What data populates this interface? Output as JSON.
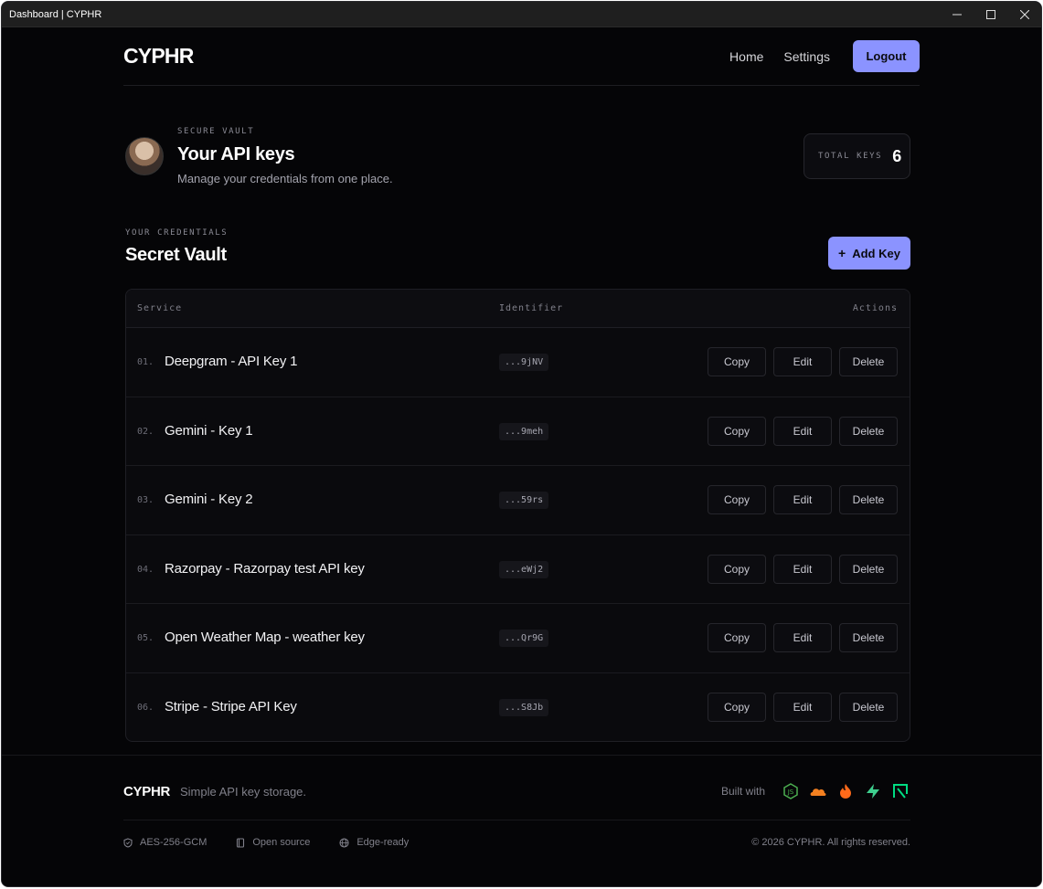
{
  "window": {
    "title": "Dashboard | CYPHR"
  },
  "nav": {
    "logo": "CYPHR",
    "links": [
      "Home",
      "Settings"
    ],
    "logout_label": "Logout"
  },
  "profile": {
    "eyebrow": "SECURE VAULT",
    "title": "Your API keys",
    "subtitle": "Manage your credentials from one place.",
    "total_keys_label": "TOTAL KEYS",
    "total_keys_value": "6"
  },
  "vault": {
    "eyebrow": "YOUR CREDENTIALS",
    "title": "Secret Vault",
    "add_label": "Add Key",
    "add_icon": "+"
  },
  "table": {
    "headers": {
      "service": "Service",
      "identifier": "Identifier",
      "actions": "Actions"
    },
    "action_labels": {
      "copy": "Copy",
      "edit": "Edit",
      "delete": "Delete"
    },
    "rows": [
      {
        "index": "01.",
        "service": "Deepgram - API Key 1",
        "identifier": "...9jNV"
      },
      {
        "index": "02.",
        "service": "Gemini - Key 1",
        "identifier": "...9meh"
      },
      {
        "index": "03.",
        "service": "Gemini - Key 2",
        "identifier": "...59rs"
      },
      {
        "index": "04.",
        "service": "Razorpay - Razorpay test API key",
        "identifier": "...eWj2"
      },
      {
        "index": "05.",
        "service": "Open Weather Map - weather key",
        "identifier": "...Qr9G"
      },
      {
        "index": "06.",
        "service": "Stripe - Stripe API Key",
        "identifier": "...S8Jb"
      }
    ]
  },
  "footer": {
    "logo": "CYPHR",
    "tagline": "Simple API key storage.",
    "built_with_label": "Built with",
    "built_with_icons": [
      "nodejs-icon",
      "cloudflare-icon",
      "firebase-icon",
      "supabase-icon",
      "nuxt-icon"
    ],
    "meta": [
      {
        "icon": "shield-icon",
        "label": "AES-256-GCM"
      },
      {
        "icon": "book-icon",
        "label": "Open source"
      },
      {
        "icon": "globe-icon",
        "label": "Edge-ready"
      }
    ],
    "copyright": "© 2026 CYPHR. All rights reserved."
  },
  "colors": {
    "accent": "#8b93ff",
    "background": "#050507"
  }
}
